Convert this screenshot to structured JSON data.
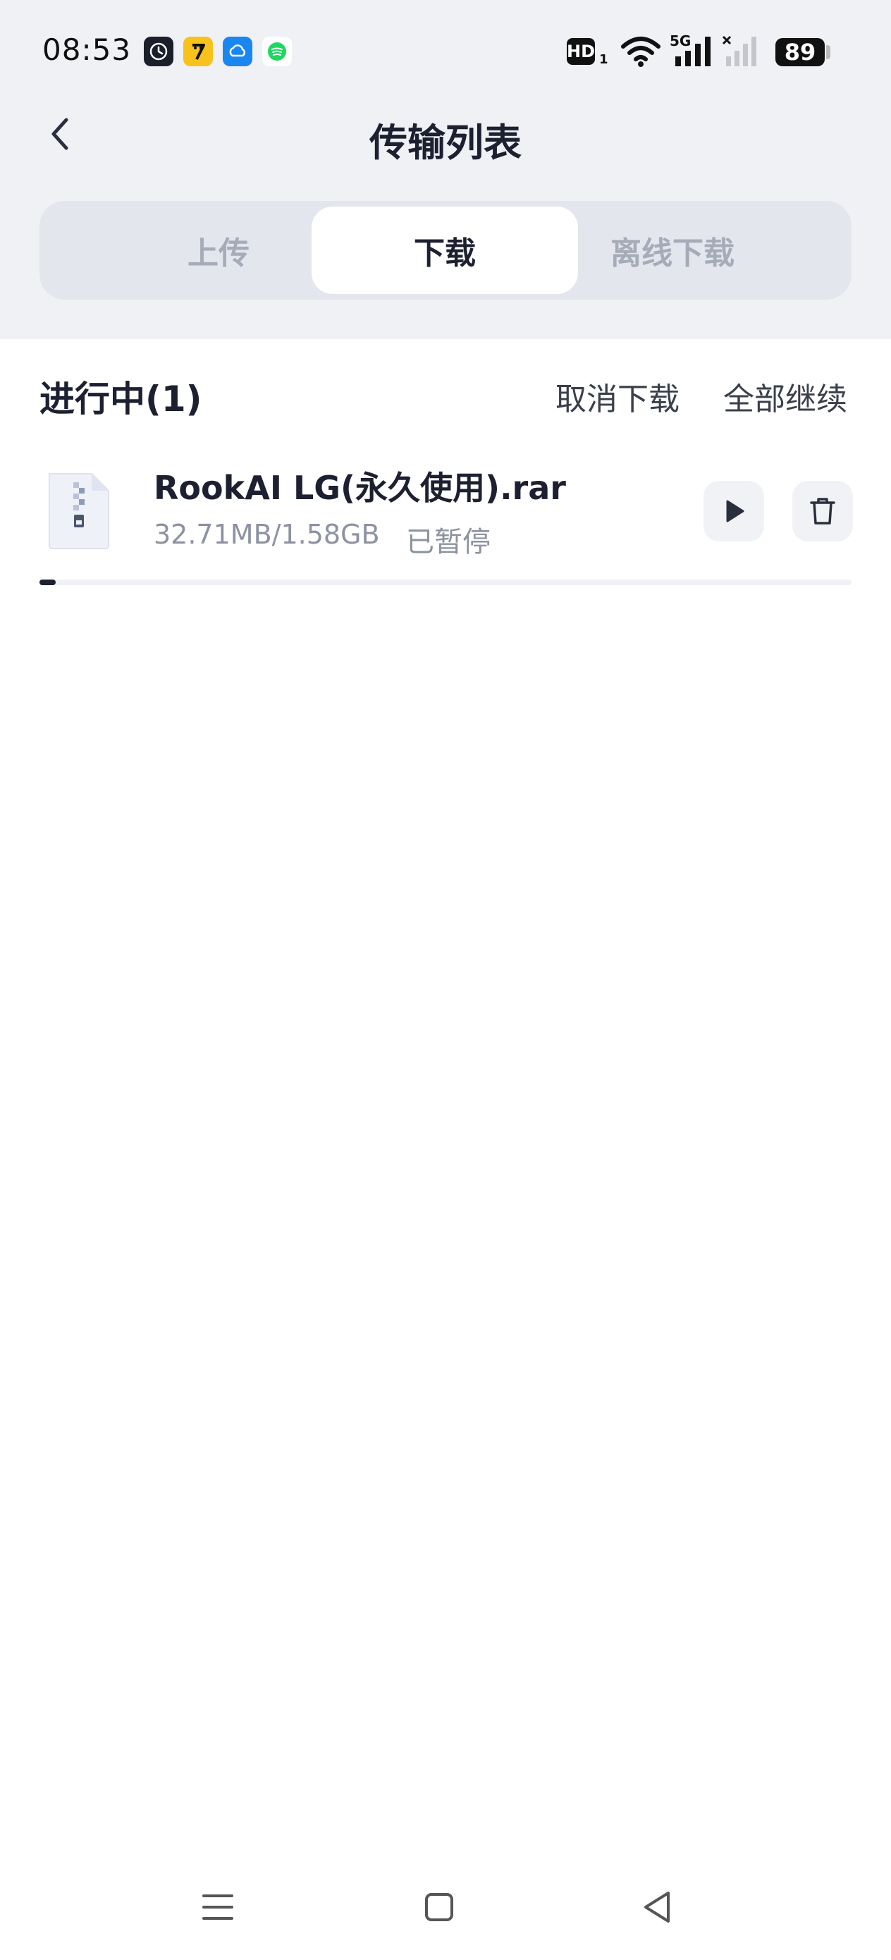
{
  "status_bar": {
    "time": "08:53",
    "hd_label": "HD",
    "hd_sub": "1",
    "network_label": "5G",
    "battery_level": "89",
    "apps": [
      "clock-app-icon",
      "qimao-app-icon",
      "cloud-app-icon",
      "spotify-app-icon"
    ]
  },
  "header": {
    "title": "传输列表",
    "back_icon": "chevron-left-icon"
  },
  "tabs": [
    {
      "label": "上传",
      "active": false
    },
    {
      "label": "下载",
      "active": true
    },
    {
      "label": "离线下载",
      "active": false
    }
  ],
  "section": {
    "title": "进行中(1)",
    "cancel_label": "取消下载",
    "resume_all_label": "全部继续"
  },
  "downloads": [
    {
      "name": "RookAI LG(永久使用).rar",
      "size": "32.71MB/1.58GB",
      "status": "已暂停",
      "progress": 0.02,
      "file_icon": "archive-file-icon",
      "actions": [
        "play-icon",
        "trash-icon"
      ]
    }
  ],
  "colors": {
    "header_bg": "#f0f1f5",
    "tab_group_bg": "#e3e6ed",
    "active_text": "#1c2030",
    "inactive_text": "#a6abb8",
    "muted_text": "#8c92a1",
    "progress_fill": "#1c2030"
  },
  "nav_bar": [
    "menu-icon",
    "home-square-icon",
    "back-triangle-icon"
  ]
}
